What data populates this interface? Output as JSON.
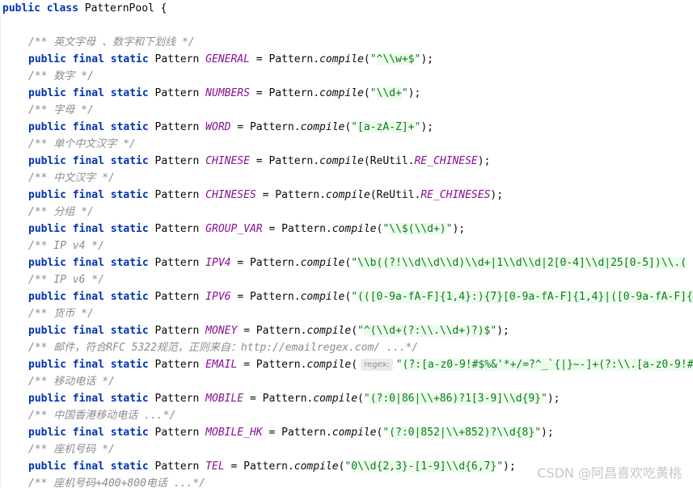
{
  "editor": {
    "lines": [
      [
        {
          "t": "kw",
          "v": "public class "
        },
        {
          "t": "pl",
          "v": "PatternPool {"
        }
      ],
      [],
      [
        {
          "t": "cm",
          "v": "/** 英文字母 、数字和下划线 */"
        }
      ],
      [
        {
          "t": "kw",
          "v": "public final static "
        },
        {
          "t": "pl",
          "v": "Pattern "
        },
        {
          "t": "fld",
          "v": "GENERAL"
        },
        {
          "t": "pl",
          "v": " = Pattern."
        },
        {
          "t": "mth",
          "v": "compile"
        },
        {
          "t": "pl",
          "v": "("
        },
        {
          "t": "str",
          "v": "\""
        },
        {
          "t": "rx",
          "v": "^\\\\w+$"
        },
        {
          "t": "str",
          "v": "\""
        },
        {
          "t": "pl",
          "v": ");"
        }
      ],
      [
        {
          "t": "cm",
          "v": "/** 数字 */"
        }
      ],
      [
        {
          "t": "kw",
          "v": "public final static "
        },
        {
          "t": "pl",
          "v": "Pattern "
        },
        {
          "t": "fld",
          "v": "NUMBERS"
        },
        {
          "t": "pl",
          "v": " = Pattern."
        },
        {
          "t": "mth",
          "v": "compile"
        },
        {
          "t": "pl",
          "v": "("
        },
        {
          "t": "str",
          "v": "\""
        },
        {
          "t": "rx",
          "v": "\\\\d+"
        },
        {
          "t": "str",
          "v": "\""
        },
        {
          "t": "pl",
          "v": ");"
        }
      ],
      [
        {
          "t": "cm",
          "v": "/** 字母 */"
        }
      ],
      [
        {
          "t": "kw",
          "v": "public final static "
        },
        {
          "t": "pl",
          "v": "Pattern "
        },
        {
          "t": "fld",
          "v": "WORD"
        },
        {
          "t": "pl",
          "v": " = Pattern."
        },
        {
          "t": "mth",
          "v": "compile"
        },
        {
          "t": "pl",
          "v": "("
        },
        {
          "t": "str",
          "v": "\""
        },
        {
          "t": "rx",
          "v": "[a-zA-Z]+"
        },
        {
          "t": "str",
          "v": "\""
        },
        {
          "t": "pl",
          "v": ");"
        }
      ],
      [
        {
          "t": "cm",
          "v": "/** 单个中文汉字 */"
        }
      ],
      [
        {
          "t": "kw",
          "v": "public final static "
        },
        {
          "t": "pl",
          "v": "Pattern "
        },
        {
          "t": "fld",
          "v": "CHINESE"
        },
        {
          "t": "pl",
          "v": " = Pattern."
        },
        {
          "t": "mth",
          "v": "compile"
        },
        {
          "t": "pl",
          "v": "(ReUtil."
        },
        {
          "t": "fld",
          "v": "RE_CHINESE"
        },
        {
          "t": "pl",
          "v": ");"
        }
      ],
      [
        {
          "t": "cm",
          "v": "/** 中文汉字 */"
        }
      ],
      [
        {
          "t": "kw",
          "v": "public final static "
        },
        {
          "t": "pl",
          "v": "Pattern "
        },
        {
          "t": "fld",
          "v": "CHINESES"
        },
        {
          "t": "pl",
          "v": " = Pattern."
        },
        {
          "t": "mth",
          "v": "compile"
        },
        {
          "t": "pl",
          "v": "(ReUtil."
        },
        {
          "t": "fld",
          "v": "RE_CHINESES"
        },
        {
          "t": "pl",
          "v": ");"
        }
      ],
      [
        {
          "t": "cm",
          "v": "/** 分组 */"
        }
      ],
      [
        {
          "t": "kw",
          "v": "public final static "
        },
        {
          "t": "pl",
          "v": "Pattern "
        },
        {
          "t": "fld",
          "v": "GROUP_VAR"
        },
        {
          "t": "pl",
          "v": " = Pattern."
        },
        {
          "t": "mth",
          "v": "compile"
        },
        {
          "t": "pl",
          "v": "("
        },
        {
          "t": "str",
          "v": "\""
        },
        {
          "t": "rx",
          "v": "\\\\$(\\\\d+)"
        },
        {
          "t": "str",
          "v": "\""
        },
        {
          "t": "pl",
          "v": ");"
        }
      ],
      [
        {
          "t": "cm",
          "v": "/** IP v4 */"
        }
      ],
      [
        {
          "t": "kw",
          "v": "public final static "
        },
        {
          "t": "pl",
          "v": "Pattern "
        },
        {
          "t": "fld",
          "v": "IPV4"
        },
        {
          "t": "pl",
          "v": " = Pattern."
        },
        {
          "t": "mth",
          "v": "compile"
        },
        {
          "t": "pl",
          "v": "("
        },
        {
          "t": "str",
          "v": "\""
        },
        {
          "t": "rx",
          "v": "\\\\b((?!\\\\d\\\\d\\\\d)\\\\d+|1\\\\d\\\\d|2[0-4]\\\\d|25[0-5])\\\\.("
        }
      ],
      [
        {
          "t": "cm",
          "v": "/** IP v6 */"
        }
      ],
      [
        {
          "t": "kw",
          "v": "public final static "
        },
        {
          "t": "pl",
          "v": "Pattern "
        },
        {
          "t": "fld",
          "v": "IPV6"
        },
        {
          "t": "pl",
          "v": " = Pattern."
        },
        {
          "t": "mth",
          "v": "compile"
        },
        {
          "t": "pl",
          "v": "("
        },
        {
          "t": "str",
          "v": "\""
        },
        {
          "t": "rx",
          "v": "(([0-9a-fA-F]{1,4}:){7}[0-9a-fA-F]{1,4}|([0-9a-fA-F]{1,4"
        }
      ],
      [
        {
          "t": "cm",
          "v": "/** 货币 */"
        }
      ],
      [
        {
          "t": "kw",
          "v": "public final static "
        },
        {
          "t": "pl",
          "v": "Pattern "
        },
        {
          "t": "fld",
          "v": "MONEY"
        },
        {
          "t": "pl",
          "v": " = Pattern."
        },
        {
          "t": "mth",
          "v": "compile"
        },
        {
          "t": "pl",
          "v": "("
        },
        {
          "t": "str",
          "v": "\""
        },
        {
          "t": "rx",
          "v": "^(\\\\d+(?:\\\\.\\\\d+)?)$"
        },
        {
          "t": "str",
          "v": "\""
        },
        {
          "t": "pl",
          "v": ");"
        }
      ],
      [
        {
          "t": "cm",
          "v": "/** 邮件，符合RFC 5322规范，正则来自：http://emailregex.com/ ...*/"
        }
      ],
      [
        {
          "t": "kw",
          "v": "public final static "
        },
        {
          "t": "pl",
          "v": "Pattern "
        },
        {
          "t": "fld",
          "v": "EMAIL"
        },
        {
          "t": "pl",
          "v": " = Pattern."
        },
        {
          "t": "mth",
          "v": "compile"
        },
        {
          "t": "pl",
          "v": "("
        },
        {
          "t": "hint",
          "v": "regex:"
        },
        {
          "t": "str",
          "v": "\""
        },
        {
          "t": "rx",
          "v": "(?:[a-z0-9!#$%&'*+/=?^_`{|}~-]+(?:\\\\.[a-z0-9!#$%"
        }
      ],
      [
        {
          "t": "cm",
          "v": "/** 移动电话 */"
        }
      ],
      [
        {
          "t": "kw",
          "v": "public final static "
        },
        {
          "t": "pl",
          "v": "Pattern "
        },
        {
          "t": "fld",
          "v": "MOBILE"
        },
        {
          "t": "pl",
          "v": " = Pattern."
        },
        {
          "t": "mth",
          "v": "compile"
        },
        {
          "t": "pl",
          "v": "("
        },
        {
          "t": "str",
          "v": "\""
        },
        {
          "t": "rx",
          "v": "(?:0|86|\\\\+86)?1[3-9]\\\\d{9}"
        },
        {
          "t": "str",
          "v": "\""
        },
        {
          "t": "pl",
          "v": ");"
        }
      ],
      [
        {
          "t": "cm",
          "v": "/** 中国香港移动电话 ...*/"
        }
      ],
      [
        {
          "t": "kw",
          "v": "public final static "
        },
        {
          "t": "pl",
          "v": "Pattern "
        },
        {
          "t": "fld",
          "v": "MOBILE_HK"
        },
        {
          "t": "pl",
          "v": " = Pattern."
        },
        {
          "t": "mth",
          "v": "compile"
        },
        {
          "t": "pl",
          "v": "("
        },
        {
          "t": "str",
          "v": "\""
        },
        {
          "t": "rx",
          "v": "(?:0|852|\\\\+852)?\\\\d{8}"
        },
        {
          "t": "str",
          "v": "\""
        },
        {
          "t": "pl",
          "v": ");"
        }
      ],
      [
        {
          "t": "cm",
          "v": "/** 座机号码 */"
        }
      ],
      [
        {
          "t": "kw",
          "v": "public final static "
        },
        {
          "t": "pl",
          "v": "Pattern "
        },
        {
          "t": "fld",
          "v": "TEL"
        },
        {
          "t": "pl",
          "v": " = Pattern."
        },
        {
          "t": "mth",
          "v": "compile"
        },
        {
          "t": "pl",
          "v": "("
        },
        {
          "t": "str",
          "v": "\""
        },
        {
          "t": "rx",
          "v": "0\\\\d{2,3}-[1-9]\\\\d{6,7}"
        },
        {
          "t": "str",
          "v": "\""
        },
        {
          "t": "pl",
          "v": ");"
        }
      ],
      [
        {
          "t": "cm",
          "v": "/** 座机号码+400+800电话 ...*/"
        }
      ]
    ]
  },
  "watermark": "CSDN @阿昌喜欢吃黄桃"
}
